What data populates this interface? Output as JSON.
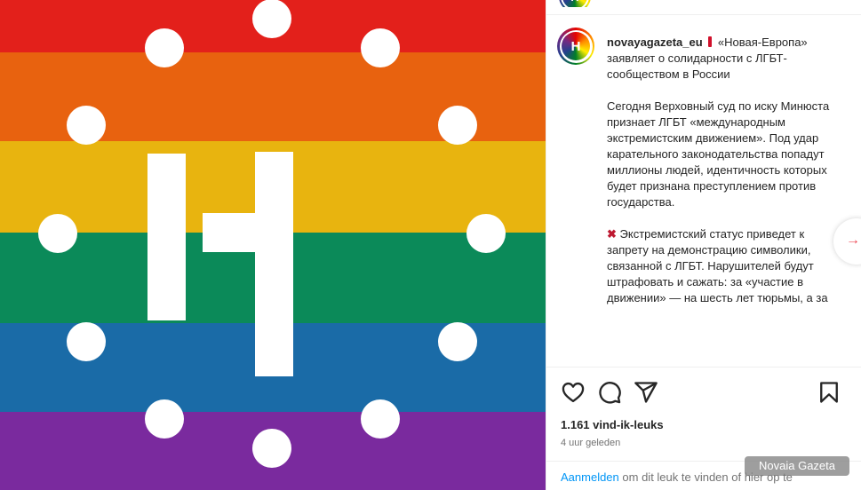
{
  "post": {
    "stripe_colors": [
      "#e3201b",
      "#e8620f",
      "#e8b40f",
      "#0b8a59",
      "#1a6ba7",
      "#7a2a9e"
    ],
    "logo_letter_color": "#ffffff"
  },
  "profile": {
    "username": "novayagazeta_eu",
    "avatar_letter": "Н"
  },
  "caption": {
    "lead": "«Новая-Европа» заявляет о солидарности с ЛГБТ-сообществом в России",
    "paragraph_1": "Сегодня Верховный суд по иску Минюста признает ЛГБТ «международным экстремистским движением». Под удар карательного законодательства попадут миллионы людей, идентичность которых будет признана преступлением против государства.",
    "x_emoji": "✖",
    "paragraph_2": "Экстремистский статус приведет к запрету на демонстрацию символики, связанной с ЛГБТ. Нарушителей будут штрафовать и сажать: за «участие в движении» — на шесть лет тюрьмы, а за"
  },
  "actions": {
    "icons": [
      "heart-icon",
      "comment-icon",
      "share-icon",
      "bookmark-icon"
    ]
  },
  "likes_text": "1.161 vind-ik-leuks",
  "time_text": "4 uur geleden",
  "login": {
    "link_label": "Aanmelden",
    "rest_text": "om dit leuk te vinden of hier op te"
  },
  "watermark": "Novaia Gazeta",
  "accent_color": "#0095f6"
}
